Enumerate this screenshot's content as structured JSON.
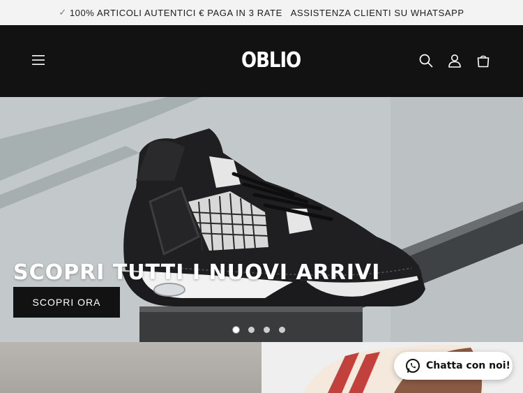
{
  "announcement": {
    "text": "100% ARTICOLI AUTENTICI € PAGA IN 3 RATE   ASSISTENZA CLIENTI SU WHATSAPP",
    "check_icon": "check-icon"
  },
  "header": {
    "logo_text": "OBLIO",
    "menu_icon": "hamburger-menu-icon",
    "search_icon": "search-icon",
    "account_icon": "user-icon",
    "cart_icon": "shopping-bag-icon",
    "background": "#121212"
  },
  "hero": {
    "title": "SCOPRI TUTTI I NUOVI ARRIVI",
    "cta_label": "SCOPRI ORA",
    "slides": [
      "slide-1",
      "slide-2",
      "slide-3",
      "slide-4"
    ],
    "active_slide": 1
  },
  "chat": {
    "label": "Chatta con noi!",
    "icon": "whatsapp-icon"
  },
  "colors": {
    "dark": "#121212",
    "announcement_bg": "#f3f3f3",
    "white": "#ffffff"
  }
}
